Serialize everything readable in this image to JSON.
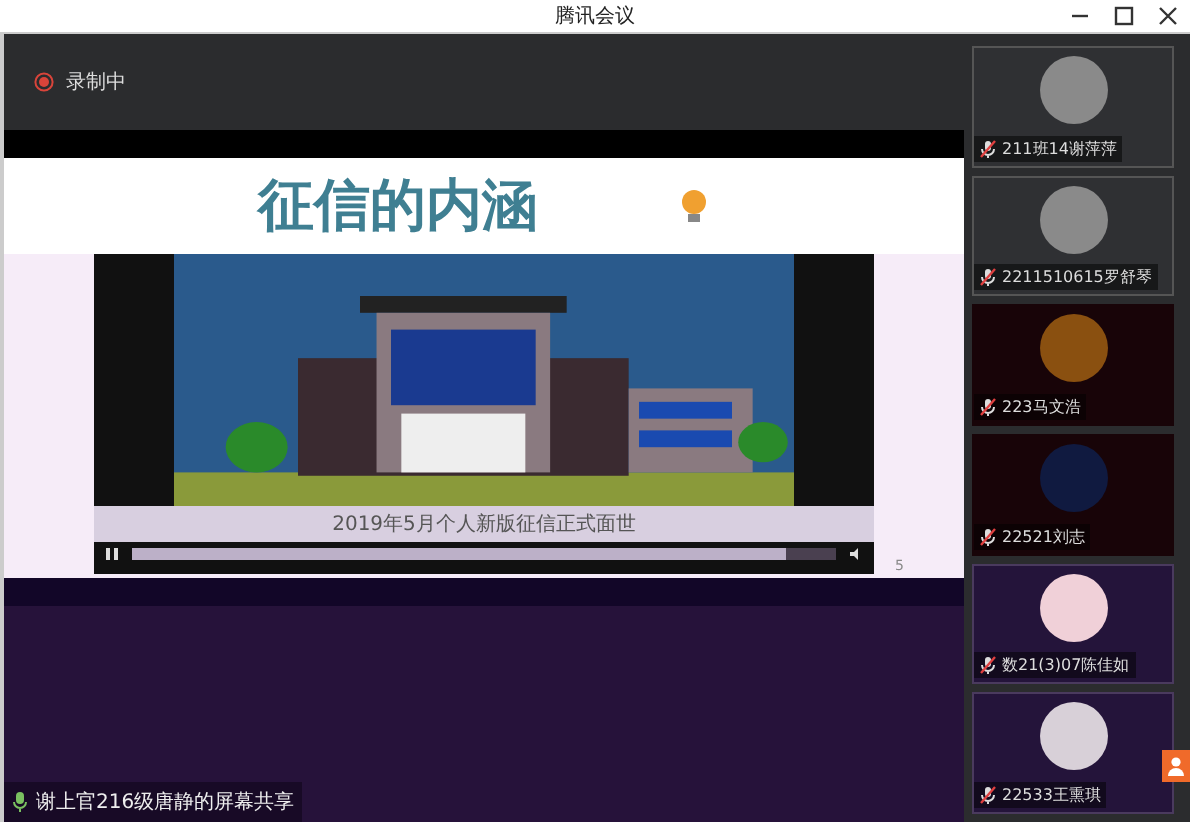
{
  "window": {
    "title": "腾讯会议"
  },
  "recording": {
    "label": "录制中"
  },
  "slide": {
    "title": "征信的内涵",
    "page": "5",
    "video": {
      "subtitle": "2019年5月个人新版征信正式面世",
      "playing": true,
      "level": 0.93
    }
  },
  "share_banner": {
    "label": "谢上官216级唐静的屏幕共享"
  },
  "participants": [
    {
      "name": "211班14谢萍萍",
      "muted": true
    },
    {
      "name": "2211510615罗舒琴",
      "muted": true
    },
    {
      "name": "223马文浩",
      "muted": true
    },
    {
      "name": "22521刘志",
      "muted": true
    },
    {
      "name": "数21(3)07陈佳如",
      "muted": true
    },
    {
      "name": "22533王熏琪",
      "muted": true
    }
  ]
}
